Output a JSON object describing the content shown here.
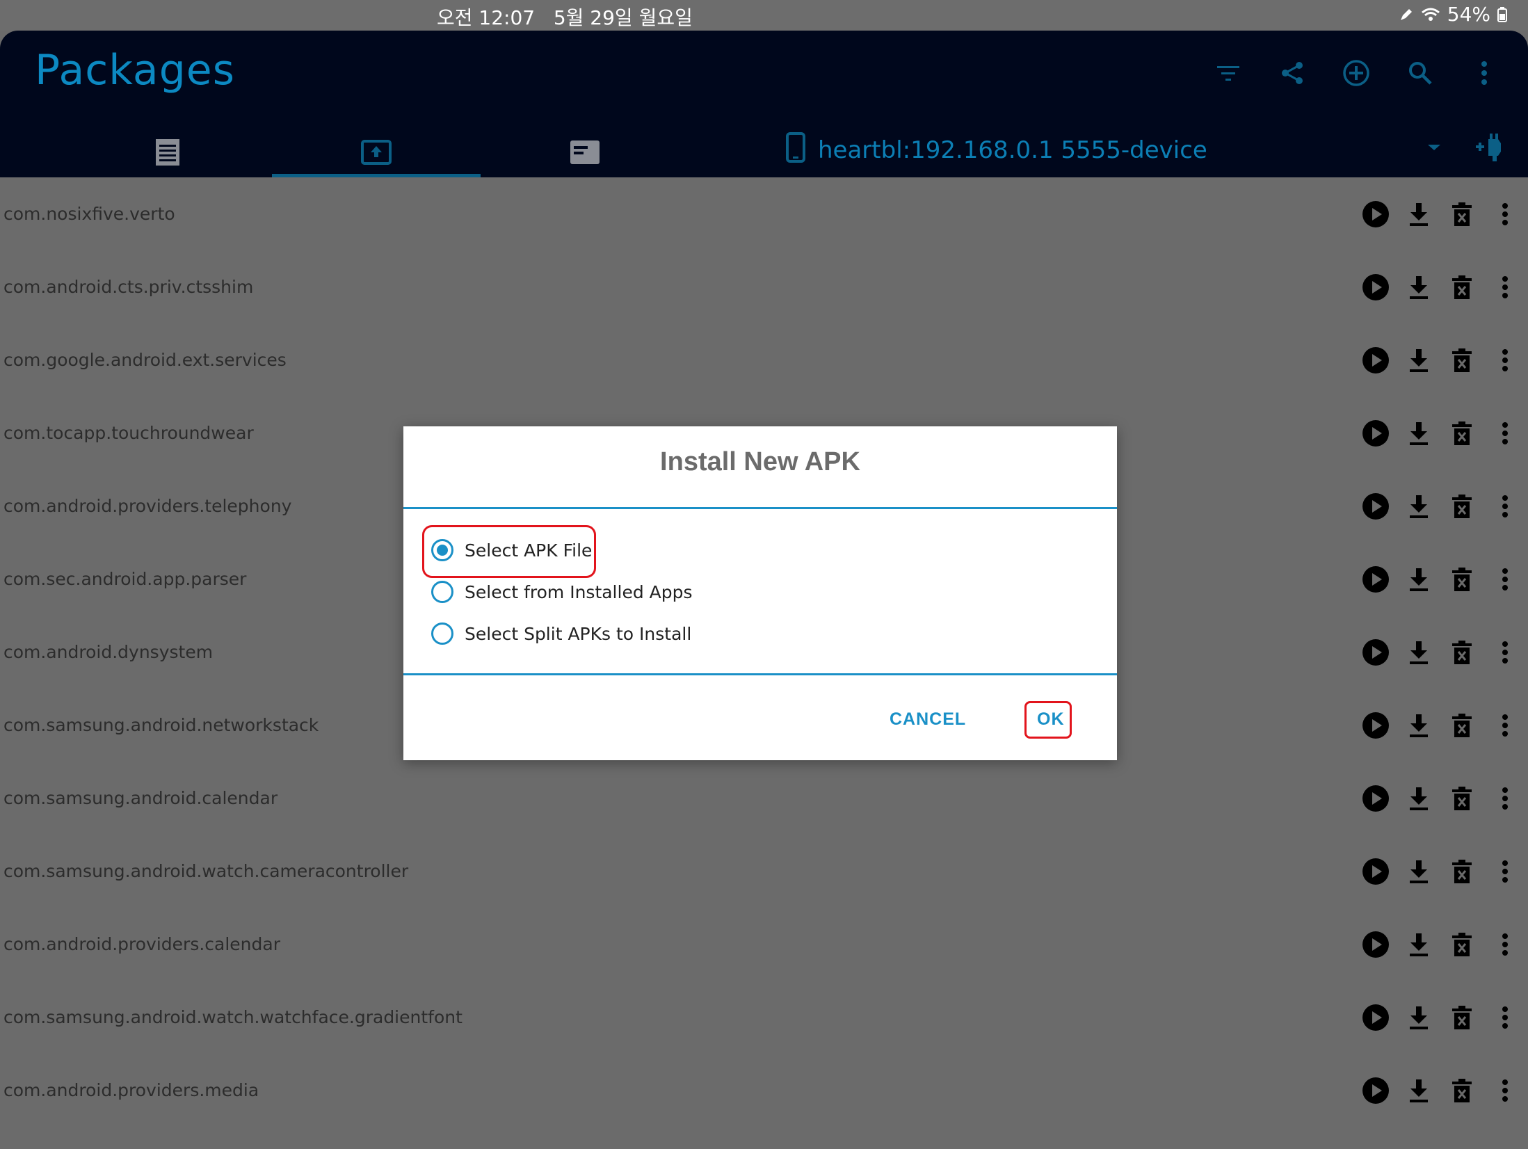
{
  "status_bar": {
    "time": "오전 12:07",
    "date": "5월 29일 월요일",
    "battery": "54%",
    "icons": [
      "pen-icon",
      "wifi-icon",
      "battery-icon"
    ]
  },
  "app": {
    "title": "Packages",
    "actions": [
      "filter-icon",
      "share-icon",
      "add-icon",
      "search-icon",
      "more-icon"
    ],
    "tabs": [
      "list-tab",
      "install-tab",
      "terminal-tab"
    ],
    "active_tab": "install-tab",
    "device_label": "heartbl:192.168.0.1 5555-device",
    "accent": "#0c89c2"
  },
  "packages": [
    "com.nosixfive.verto",
    "com.android.cts.priv.ctsshim",
    "com.google.android.ext.services",
    "com.tocapp.touchroundwear",
    "com.android.providers.telephony",
    "com.sec.android.app.parser",
    "com.android.dynsystem",
    "com.samsung.android.networkstack",
    "com.samsung.android.calendar",
    "com.samsung.android.watch.cameracontroller",
    "com.android.providers.calendar",
    "com.samsung.android.watch.watchface.gradientfont",
    "com.android.providers.media"
  ],
  "row_actions": [
    "play-icon",
    "download-icon",
    "delete-icon",
    "more-icon"
  ],
  "dialog": {
    "title": "Install New APK",
    "options": [
      {
        "label": "Select APK File",
        "selected": true
      },
      {
        "label": "Select from Installed Apps",
        "selected": false
      },
      {
        "label": "Select Split APKs to Install",
        "selected": false
      }
    ],
    "cancel_label": "CANCEL",
    "ok_label": "OK",
    "accent": "#1a90c7",
    "highlight_color": "#e2141c"
  }
}
